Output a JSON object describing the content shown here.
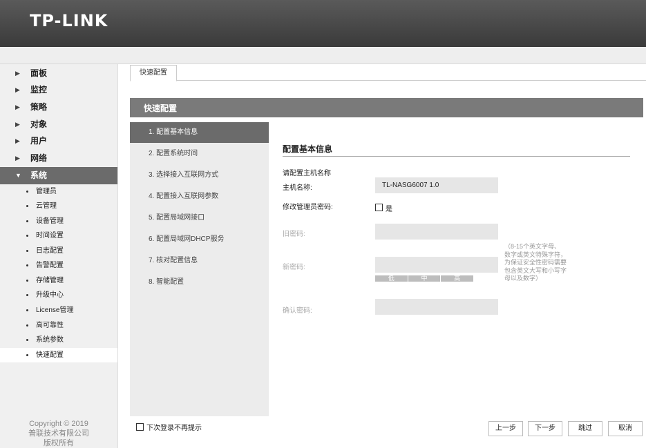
{
  "header": {
    "logo": "TP-LINK"
  },
  "sidebar": {
    "menu": [
      {
        "label": "面板"
      },
      {
        "label": "监控"
      },
      {
        "label": "策略"
      },
      {
        "label": "对象"
      },
      {
        "label": "用户"
      },
      {
        "label": "网络"
      },
      {
        "label": "系统"
      }
    ],
    "submenu": [
      {
        "label": "管理员"
      },
      {
        "label": "云管理"
      },
      {
        "label": "设备管理"
      },
      {
        "label": "时间设置"
      },
      {
        "label": "日志配置"
      },
      {
        "label": "告警配置"
      },
      {
        "label": "存储管理"
      },
      {
        "label": "升级中心"
      },
      {
        "label": "License管理"
      },
      {
        "label": "高可靠性"
      },
      {
        "label": "系统参数"
      },
      {
        "label": "快速配置"
      }
    ],
    "copyright": [
      "Copyright © 2019",
      "普联技术有限公司",
      "版权所有"
    ]
  },
  "tabs": [
    {
      "label": "快速配置"
    }
  ],
  "panel_title": "快速配置",
  "steps": [
    {
      "label": "1. 配置基本信息"
    },
    {
      "label": "2. 配置系统时间"
    },
    {
      "label": "3. 选择接入互联网方式"
    },
    {
      "label": "4. 配置接入互联网参数"
    },
    {
      "label": "5. 配置局域网接口"
    },
    {
      "label": "6. 配置局域网DHCP服务"
    },
    {
      "label": "7. 核对配置信息"
    },
    {
      "label": "8. 智能配置"
    }
  ],
  "form": {
    "section_title": "配置基本信息",
    "prompt": "请配置主机名称",
    "hostname_label": "主机名称:",
    "hostname_value": "TL-NASG6007 1.0",
    "change_pwd_label": "修改管理员密码:",
    "change_pwd_option": "是",
    "old_pwd_label": "旧密码:",
    "new_pwd_label": "新密码:",
    "confirm_pwd_label": "确认密码:",
    "strength": [
      "低",
      "中",
      "高"
    ],
    "hint": [
      "（8-15个英文字母、",
      "数字或英文特殊字符，",
      "为保证安全性密码需要",
      "包含英文大写和小写字",
      "母以及数字）"
    ]
  },
  "footer": {
    "no_prompt_label": "下次登录不再提示",
    "prev": "上一步",
    "next": "下一步",
    "skip": "跳过",
    "cancel": "取消"
  }
}
